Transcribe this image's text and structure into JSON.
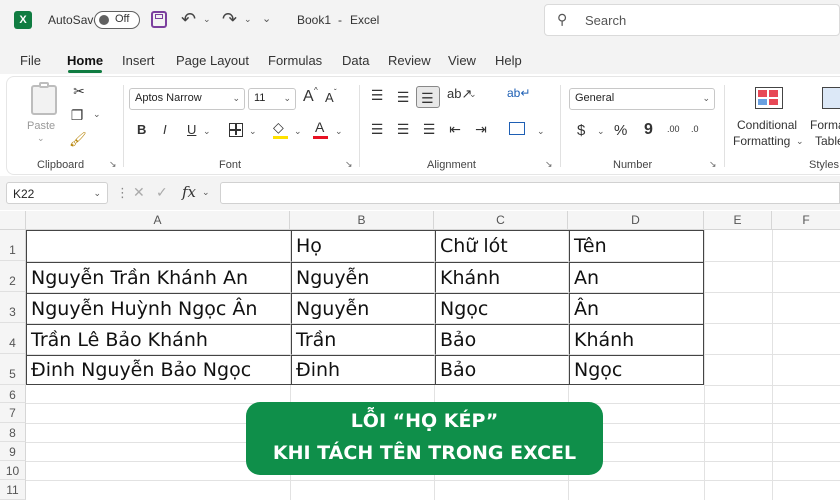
{
  "titlebar": {
    "autosave_label": "AutoSave",
    "autosave_state": "Off",
    "doc_title": "Book1",
    "separator": "-",
    "app_name": "Excel",
    "search_placeholder": "Search"
  },
  "menu": [
    "File",
    "Home",
    "Insert",
    "Page Layout",
    "Formulas",
    "Data",
    "Review",
    "View",
    "Help"
  ],
  "active_tab": "Home",
  "ribbon": {
    "clipboard": {
      "label": "Clipboard",
      "paste": "Paste"
    },
    "font": {
      "label": "Font",
      "font_name": "Aptos Narrow",
      "font_size": "11",
      "bold": "B",
      "italic": "I",
      "underline": "U",
      "grow": "A",
      "shrink": "A"
    },
    "alignment": {
      "label": "Alignment"
    },
    "number": {
      "label": "Number",
      "format": "General",
      "currency": "$",
      "percent": "%",
      "comma": "9",
      "inc_dec": ".00",
      "dec_dec": ".0"
    },
    "styles": {
      "label": "Styles",
      "cond_fmt_line1": "Conditional",
      "cond_fmt_line2": "Formatting",
      "format_table_line1": "Forma",
      "format_table_line2": "Table"
    }
  },
  "formula_bar": {
    "name_box": "K22",
    "fx": "fx",
    "value": ""
  },
  "columns": [
    "A",
    "B",
    "C",
    "D",
    "E",
    "F"
  ],
  "rows": [
    "1",
    "2",
    "3",
    "4",
    "5",
    "6",
    "7",
    "8",
    "9",
    "10",
    "11"
  ],
  "cells": [
    [
      "",
      "Họ",
      "Chữ lót",
      "Tên"
    ],
    [
      "Nguyễn Trần Khánh An",
      "Nguyễn",
      "Khánh",
      "An"
    ],
    [
      "Nguyễn Huỳnh Ngọc Ân",
      "Nguyễn",
      "Ngọc",
      "Ân"
    ],
    [
      "Trần Lê Bảo Khánh",
      "Trần",
      "Bảo",
      "Khánh"
    ],
    [
      "Đinh Nguyễn Bảo Ngọc",
      "Đinh",
      "Bảo",
      "Ngọc"
    ]
  ],
  "banner": {
    "line1": "LỖI “HỌ KÉP”",
    "line2": "KHI TÁCH TÊN TRONG EXCEL",
    "color": "#0f8f4a"
  },
  "colors": {
    "accent": "#107c41",
    "chrome": "#f3f3f3"
  }
}
